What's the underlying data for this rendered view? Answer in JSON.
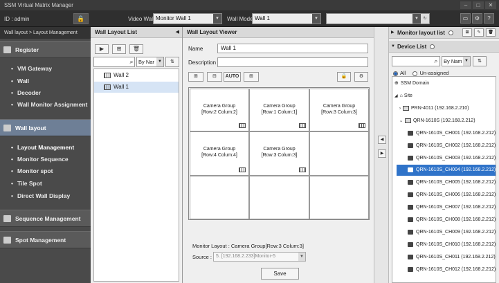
{
  "app": {
    "title": "SSM Virtual Matrix Manager"
  },
  "header": {
    "user_id": "ID : admin",
    "video_wall_label": "Video Wall",
    "video_wall_value": "Monitor Wall 1",
    "wall_mode_label": "Wall Mode",
    "wall_mode_value": "Wall 1"
  },
  "breadcrumb": "Wall layout  > Layout Management",
  "nav": {
    "register": "Register",
    "register_items": [
      "VM Gateway",
      "Wall",
      "Decoder",
      "Wall Monitor Assignment"
    ],
    "wall_layout": "Wall layout",
    "wall_layout_items": [
      "Layout Management",
      "Monitor Sequence",
      "Monitor spot",
      "Tile Spot",
      "Direct Wall Display"
    ],
    "sequence_management": "Sequence Management",
    "spot_management": "Spot Management"
  },
  "wall_layout_list": {
    "title": "Wall Layout List",
    "sort_value": "By Nar",
    "items": [
      "Wall 2",
      "Wall 1"
    ],
    "selected_index": 1
  },
  "viewer": {
    "title": "Wall Layout Viewer",
    "name_label": "Name",
    "name_value": "Wall 1",
    "description_label": "Description",
    "description_value": "",
    "cells": [
      {
        "line1": "Camera Group",
        "line2": "[Row:2 Colum:2]"
      },
      {
        "line1": "Camera Group",
        "line2": "[Row:1 Colum:1]"
      },
      {
        "line1": "Camera Group",
        "line2": "[Row:3 Colum:3]"
      },
      {
        "line1": "Camera Group",
        "line2": "[Row:4 Colum:4]"
      },
      {
        "line1": "Camera Group",
        "line2": "[Row:3 Colum:3]"
      },
      {
        "line1": "",
        "line2": ""
      },
      {
        "line1": "",
        "line2": ""
      },
      {
        "line1": "",
        "line2": ""
      },
      {
        "line1": "",
        "line2": ""
      }
    ],
    "monitor_layout": "Monitor Layout : Camera Group[Row:3 Colum:3]",
    "source_label": "Source :",
    "source_value": "5. [192.168.2.233]Monitor-5",
    "save_label": "Save",
    "tool_auto": "AUTO"
  },
  "right": {
    "monitor_layout_list": "Monitor layout list",
    "device_list": "Device List",
    "sort_value": "By Nam",
    "radio_all": "All",
    "radio_unassigned": "Un-assigned",
    "tree": {
      "root": "SSM Domain",
      "site": "Site",
      "nvr1": "PRN-4011 (192.168.2.210)",
      "nvr2": "QRN-1610S (192.168.2.212)",
      "cameras": [
        "QRN-1610S_CH001 (192.168.2.212)",
        "QRN-1610S_CH002 (192.168.2.212)",
        "QRN-1610S_CH003 (192.168.2.212)",
        "QRN-1610S_CH004 (192.168.2.212)",
        "QRN-1610S_CH005 (192.168.2.212)",
        "QRN-1610S_CH006 (192.168.2.212)",
        "QRN-1610S_CH007 (192.168.2.212)",
        "QRN-1610S_CH008 (192.168.2.212)",
        "QRN-1610S_CH009 (192.168.2.212)",
        "QRN-1610S_CH010 (192.168.2.212)",
        "QRN-1610S_CH011 (192.168.2.212)",
        "QRN-1610S_CH012 (192.168.2.212)"
      ],
      "selected_camera_index": 3
    }
  }
}
